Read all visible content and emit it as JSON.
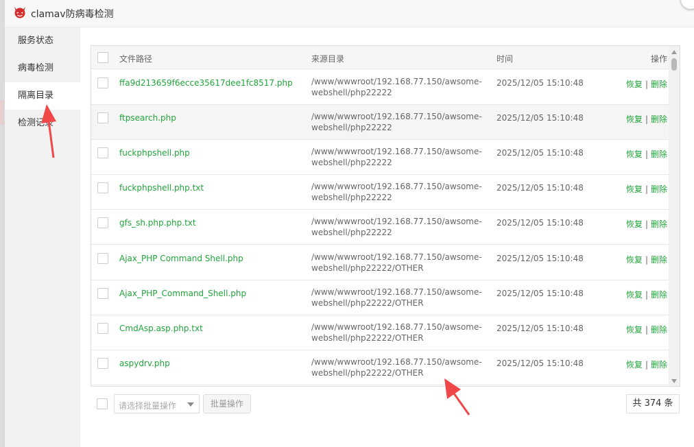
{
  "window": {
    "title": "clamav防病毒检测",
    "logo_icon": "devil-face-icon",
    "close_icon": "close-icon"
  },
  "colors": {
    "accent_green": "#20a53a",
    "arrow_red": "#f04848"
  },
  "sidebar": {
    "items": [
      {
        "label": "服务状态"
      },
      {
        "label": "病毒检测"
      },
      {
        "label": "隔离目录"
      },
      {
        "label": "检测记录"
      }
    ],
    "active_index": 2
  },
  "table": {
    "headers": {
      "path": "文件路径",
      "source": "来源目录",
      "time": "时间",
      "actions": "操作"
    },
    "rows": [
      {
        "file": "ffa9d213659f6ecce35617dee1fc8517.php",
        "source_line1": "/www/wwwroot/192.168.77.150/awsome-",
        "source_line2": "webshell/php22222",
        "time": "2025/12/05 15:10:48",
        "restore": "恢复",
        "delete": "删除"
      },
      {
        "file": "ftpsearch.php",
        "source_line1": "/www/wwwroot/192.168.77.150/awsome-",
        "source_line2": "webshell/php22222",
        "time": "2025/12/05 15:10:48",
        "restore": "恢复",
        "delete": "删除"
      },
      {
        "file": "fuckphpshell.php",
        "source_line1": "/www/wwwroot/192.168.77.150/awsome-",
        "source_line2": "webshell/php22222",
        "time": "2025/12/05 15:10:48",
        "restore": "恢复",
        "delete": "删除"
      },
      {
        "file": "fuckphpshell.php.txt",
        "source_line1": "/www/wwwroot/192.168.77.150/awsome-",
        "source_line2": "webshell/php22222",
        "time": "2025/12/05 15:10:48",
        "restore": "恢复",
        "delete": "删除"
      },
      {
        "file": "gfs_sh.php.php.txt",
        "source_line1": "/www/wwwroot/192.168.77.150/awsome-",
        "source_line2": "webshell/php22222",
        "time": "2025/12/05 15:10:48",
        "restore": "恢复",
        "delete": "删除"
      },
      {
        "file": "Ajax_PHP Command Shell.php",
        "source_line1": "/www/wwwroot/192.168.77.150/awsome-",
        "source_line2": "webshell/php22222/OTHER",
        "time": "2025/12/05 15:10:48",
        "restore": "恢复",
        "delete": "删除"
      },
      {
        "file": "Ajax_PHP_Command_Shell.php",
        "source_line1": "/www/wwwroot/192.168.77.150/awsome-",
        "source_line2": "webshell/php22222/OTHER",
        "time": "2025/12/05 15:10:48",
        "restore": "恢复",
        "delete": "删除"
      },
      {
        "file": "CmdAsp.asp.php.txt",
        "source_line1": "/www/wwwroot/192.168.77.150/awsome-",
        "source_line2": "webshell/php22222/OTHER",
        "time": "2025/12/05 15:10:48",
        "restore": "恢复",
        "delete": "删除"
      },
      {
        "file": "aspydrv.php",
        "source_line1": "/www/wwwroot/192.168.77.150/awsome-",
        "source_line2": "webshell/php22222/OTHER",
        "time": "2025/12/05 15:10:48",
        "restore": "恢复",
        "delete": "删除"
      }
    ]
  },
  "footer": {
    "batch_select_placeholder": "请选择批量操作",
    "batch_button": "批量操作",
    "total": "共 374 条"
  }
}
